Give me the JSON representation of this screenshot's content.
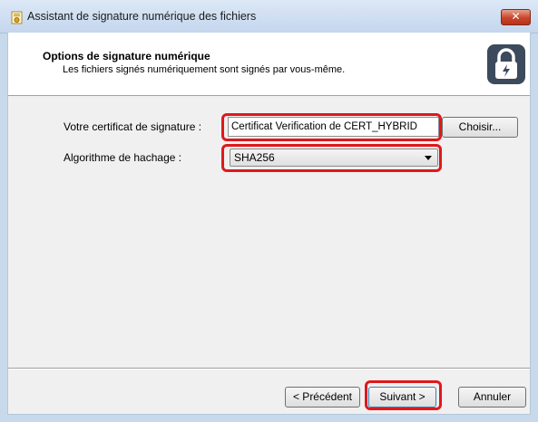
{
  "window": {
    "title": "Assistant de signature numérique des fichiers",
    "close_label": "✕"
  },
  "header": {
    "title": "Options de signature numérique",
    "subtitle": "Les fichiers signés numériquement sont signés par vous-même."
  },
  "form": {
    "certificate_label": "Votre certificat de signature :",
    "certificate_value": "Certificat Verification de CERT_HYBRID",
    "choose_button": "Choisir...",
    "hash_label": "Algorithme de hachage :",
    "hash_value": "SHA256"
  },
  "footer": {
    "previous_button": "< Précédent",
    "next_button": "Suivant >",
    "cancel_button": "Annuler"
  },
  "colors": {
    "highlight": "#e0181b",
    "titlebar": "#c4d6ee",
    "dialog_bg": "#f0f0f0"
  },
  "icons": {
    "title": "certificate-icon",
    "header": "lock-icon"
  }
}
